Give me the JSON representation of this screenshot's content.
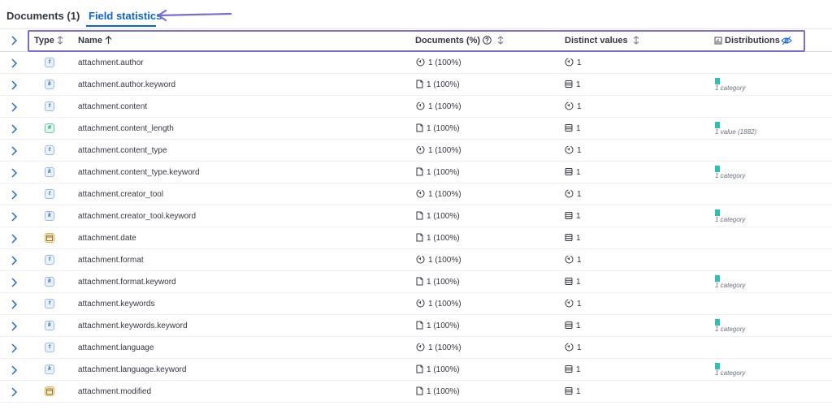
{
  "tabs": [
    {
      "label": "Documents (1)",
      "active": false
    },
    {
      "label": "Field statistics",
      "active": true
    }
  ],
  "colors": {
    "accent": "#0b64dd",
    "highlight": "#7b6bd3",
    "distribution_bar": "#2ac3b2"
  },
  "table": {
    "headers": {
      "type": "Type",
      "name": "Name",
      "documents": "Documents (%)",
      "distinct": "Distinct values",
      "distributions": "Distributions"
    },
    "rows": [
      {
        "type": "text",
        "type_glyph": "t",
        "name": "attachment.author",
        "docs_icon": "clock",
        "docs": "1 (100%)",
        "distinct_icon": "clock",
        "distinct": "1",
        "distribution": ""
      },
      {
        "type": "keyword",
        "type_glyph": "k",
        "name": "attachment.author.keyword",
        "docs_icon": "doc",
        "docs": "1 (100%)",
        "distinct_icon": "db",
        "distinct": "1",
        "distribution": "1 category"
      },
      {
        "type": "text",
        "type_glyph": "t",
        "name": "attachment.content",
        "docs_icon": "clock",
        "docs": "1 (100%)",
        "distinct_icon": "clock",
        "distinct": "1",
        "distribution": ""
      },
      {
        "type": "number",
        "type_glyph": "#",
        "name": "attachment.content_length",
        "docs_icon": "doc",
        "docs": "1 (100%)",
        "distinct_icon": "db",
        "distinct": "1",
        "distribution": "1 value (1882)"
      },
      {
        "type": "text",
        "type_glyph": "t",
        "name": "attachment.content_type",
        "docs_icon": "clock",
        "docs": "1 (100%)",
        "distinct_icon": "clock",
        "distinct": "1",
        "distribution": ""
      },
      {
        "type": "keyword",
        "type_glyph": "k",
        "name": "attachment.content_type.keyword",
        "docs_icon": "doc",
        "docs": "1 (100%)",
        "distinct_icon": "db",
        "distinct": "1",
        "distribution": "1 category"
      },
      {
        "type": "text",
        "type_glyph": "t",
        "name": "attachment.creator_tool",
        "docs_icon": "clock",
        "docs": "1 (100%)",
        "distinct_icon": "clock",
        "distinct": "1",
        "distribution": ""
      },
      {
        "type": "keyword",
        "type_glyph": "k",
        "name": "attachment.creator_tool.keyword",
        "docs_icon": "doc",
        "docs": "1 (100%)",
        "distinct_icon": "db",
        "distinct": "1",
        "distribution": "1 category"
      },
      {
        "type": "date",
        "type_glyph": "",
        "name": "attachment.date",
        "docs_icon": "doc",
        "docs": "1 (100%)",
        "distinct_icon": "db",
        "distinct": "1",
        "distribution": ""
      },
      {
        "type": "text",
        "type_glyph": "t",
        "name": "attachment.format",
        "docs_icon": "clock",
        "docs": "1 (100%)",
        "distinct_icon": "clock",
        "distinct": "1",
        "distribution": ""
      },
      {
        "type": "keyword",
        "type_glyph": "k",
        "name": "attachment.format.keyword",
        "docs_icon": "doc",
        "docs": "1 (100%)",
        "distinct_icon": "db",
        "distinct": "1",
        "distribution": "1 category"
      },
      {
        "type": "text",
        "type_glyph": "t",
        "name": "attachment.keywords",
        "docs_icon": "clock",
        "docs": "1 (100%)",
        "distinct_icon": "clock",
        "distinct": "1",
        "distribution": ""
      },
      {
        "type": "keyword",
        "type_glyph": "k",
        "name": "attachment.keywords.keyword",
        "docs_icon": "doc",
        "docs": "1 (100%)",
        "distinct_icon": "db",
        "distinct": "1",
        "distribution": "1 category"
      },
      {
        "type": "text",
        "type_glyph": "t",
        "name": "attachment.language",
        "docs_icon": "clock",
        "docs": "1 (100%)",
        "distinct_icon": "clock",
        "distinct": "1",
        "distribution": ""
      },
      {
        "type": "keyword",
        "type_glyph": "k",
        "name": "attachment.language.keyword",
        "docs_icon": "doc",
        "docs": "1 (100%)",
        "distinct_icon": "db",
        "distinct": "1",
        "distribution": "1 category"
      },
      {
        "type": "date",
        "type_glyph": "",
        "name": "attachment.modified",
        "docs_icon": "doc",
        "docs": "1 (100%)",
        "distinct_icon": "db",
        "distinct": "1",
        "distribution": ""
      }
    ]
  }
}
